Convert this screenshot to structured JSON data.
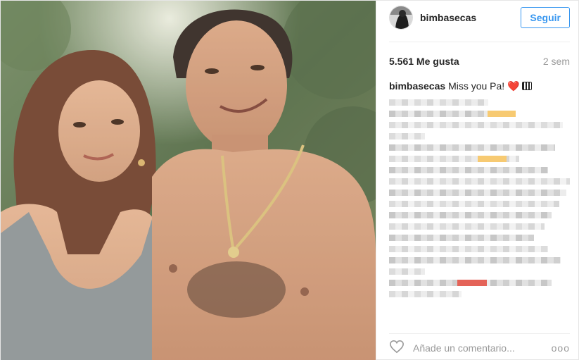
{
  "post": {
    "username": "bimbasecas",
    "follow_label": "Seguir",
    "likes": "5.561 Me gusta",
    "time": "2 sem",
    "caption_user": "bimbasecas",
    "caption_text": "Miss you Pa!",
    "heart_emoji": "❤️",
    "comment_placeholder": "Añade un comentario...",
    "more_label": "ooo"
  },
  "colors": {
    "accent": "#3897f0",
    "text": "#262626",
    "muted": "#999999",
    "blur_highlight_yellow": "#f6c15a",
    "blur_highlight_red": "#e0483c"
  },
  "icons": {
    "like": "heart-outline-icon",
    "more": "more-options-icon",
    "caption_emoji": "piano-emoji-icon"
  }
}
